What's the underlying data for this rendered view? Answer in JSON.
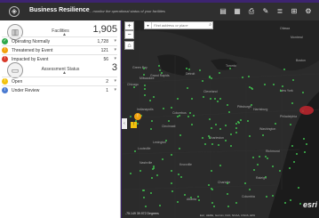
{
  "header": {
    "title": "Business Resilience",
    "subtitle": "... monitor the operational status of your facilities",
    "icons": [
      "layers-icon",
      "basemap-icon",
      "print-icon",
      "share-icon",
      "legend-icon",
      "grid-icon",
      "settings-icon"
    ]
  },
  "panel": {
    "facilities": {
      "label": "Facilities",
      "total": "1,905",
      "rows": [
        {
          "label": "Operating Normally",
          "value": "1,728",
          "color": "#2ea84a",
          "icon": "check-icon"
        },
        {
          "label": "Threatened by Event",
          "value": "121",
          "color": "#f2a20d",
          "icon": "warning-icon"
        },
        {
          "label": "Impacted by Event",
          "value": "56",
          "color": "#d93a2b",
          "icon": "alert-icon"
        }
      ]
    },
    "assessment": {
      "label": "Assessment Status",
      "total": "3",
      "rows": [
        {
          "label": "Open",
          "value": "2",
          "color": "#f2c20d",
          "icon": "exclamation-icon"
        },
        {
          "label": "Under Review",
          "value": "1",
          "color": "#4a7bd1",
          "icon": "info-icon"
        }
      ]
    }
  },
  "map": {
    "search_placeholder": "Find address or place",
    "coordinates": "-75.149  39.972 Degrees",
    "attribution": "Esri, HERE, Garmin, FAO, NOAA, USGS, EPA",
    "esri_logo": "esri",
    "cities": [
      {
        "name": "Ottawa"
      },
      {
        "name": "Montreal"
      },
      {
        "name": "Green Bay"
      },
      {
        "name": "Grand Rapids"
      },
      {
        "name": "Toronto"
      },
      {
        "name": "Milwaukee"
      },
      {
        "name": "Detroit"
      },
      {
        "name": "Boston"
      },
      {
        "name": "Chicago"
      },
      {
        "name": "Cleveland"
      },
      {
        "name": "New York"
      },
      {
        "name": "Pittsburgh"
      },
      {
        "name": "Indianapolis"
      },
      {
        "name": "Columbus"
      },
      {
        "name": "Philadelphia"
      },
      {
        "name": "Harrisburg"
      },
      {
        "name": "Cincinnati"
      },
      {
        "name": "Washington"
      },
      {
        "name": "Lexington"
      },
      {
        "name": "Charleston"
      },
      {
        "name": "Louisville"
      },
      {
        "name": "Richmond"
      },
      {
        "name": "Nashville"
      },
      {
        "name": "Knoxville"
      },
      {
        "name": "Charlotte"
      },
      {
        "name": "Raleigh"
      },
      {
        "name": "Atlanta"
      },
      {
        "name": "Columbia"
      }
    ]
  }
}
